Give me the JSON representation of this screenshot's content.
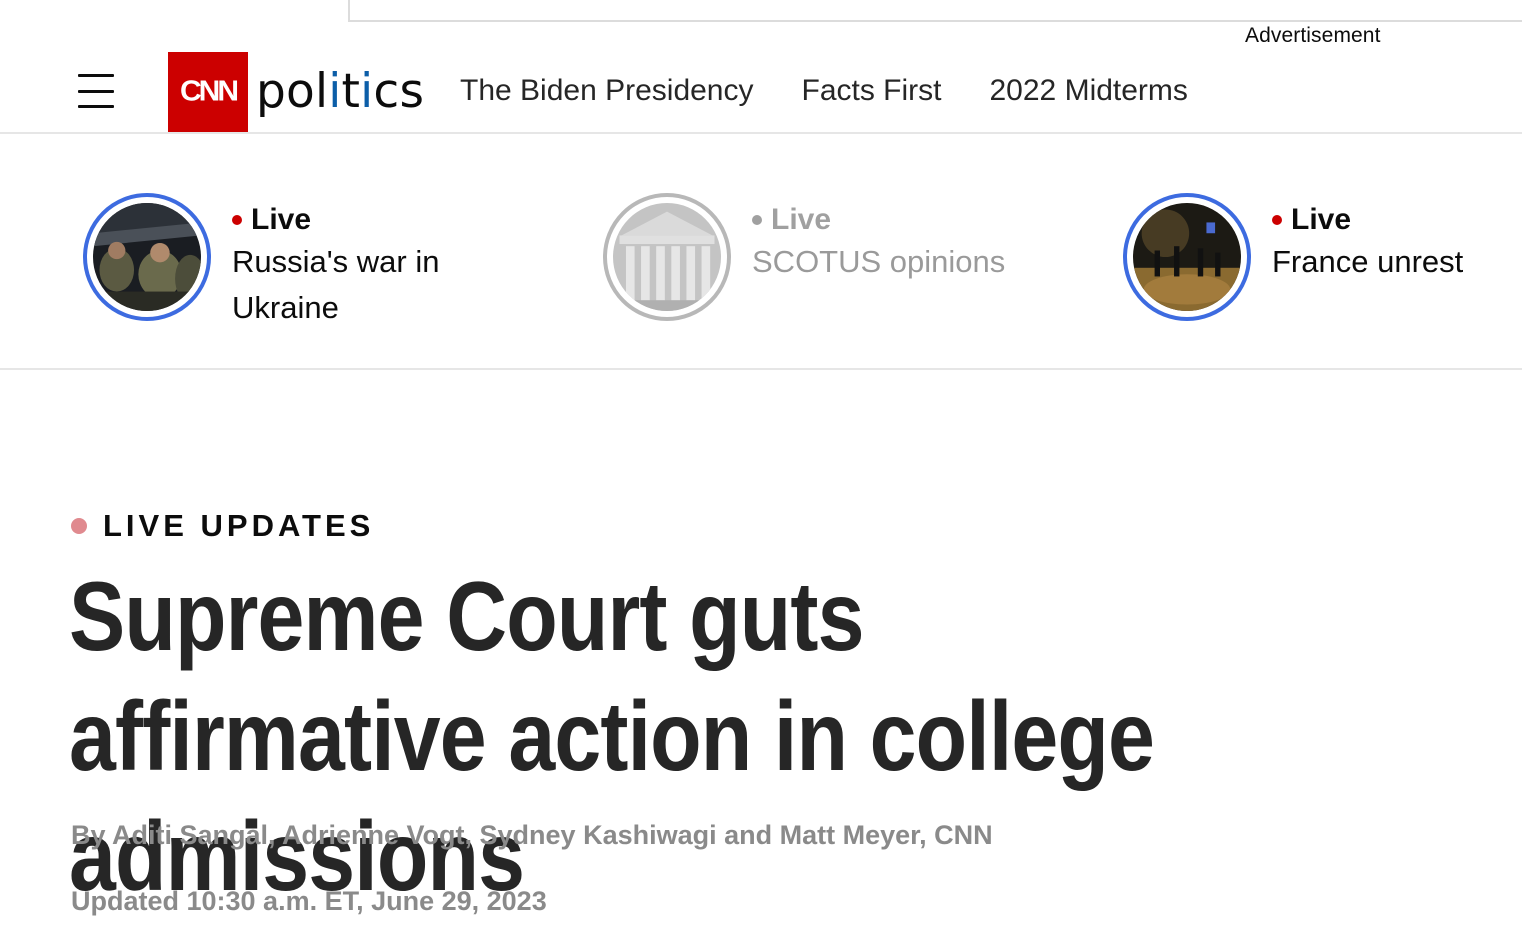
{
  "ad": {
    "label": "Advertisement"
  },
  "header": {
    "logo_text": "CNN",
    "section_prefix": "pol",
    "section_accent": "i",
    "section_middle": "t",
    "section_accent2": "i",
    "section_suffix": "cs",
    "nav": [
      {
        "label": "The Biden Presidency"
      },
      {
        "label": "Facts First"
      },
      {
        "label": "2022 Midterms"
      }
    ]
  },
  "live_stories": [
    {
      "tag": "Live",
      "title": "Russia's war in Ukraine",
      "state": "active"
    },
    {
      "tag": "Live",
      "title": "SCOTUS opinions",
      "state": "muted"
    },
    {
      "tag": "Live",
      "title": "France unrest",
      "state": "active"
    }
  ],
  "article": {
    "kicker": "LIVE UPDATES",
    "headline": "Supreme Court guts affirmative action in college admissions",
    "byline": "By Aditi Sangal, Adrienne Vogt, Sydney Kashiwagi and Matt Meyer, CNN",
    "updated": "Updated 10:30 a.m. ET, June 29, 2023"
  },
  "colors": {
    "brand_red": "#cc0000",
    "ring_blue": "#3d6be0",
    "muted_gray": "#9a9a9a",
    "kicker_dot": "#e08a8f"
  }
}
